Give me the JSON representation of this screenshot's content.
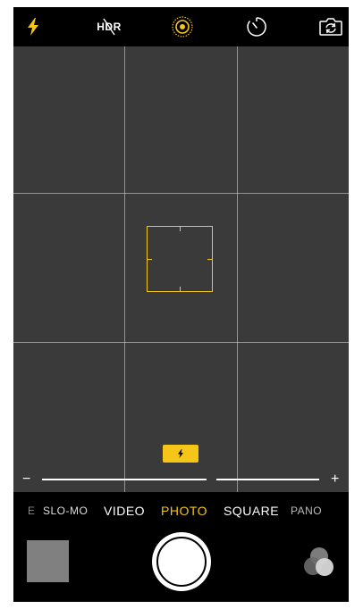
{
  "topbar": {
    "flash_icon": "flash-icon",
    "hdr_label": "HDR",
    "live_photo_icon": "live-photo-icon",
    "timer_icon": "timer-icon",
    "switch_camera_icon": "switch-camera-icon"
  },
  "viewfinder": {
    "grid": "3x3",
    "flash_badge_icon": "flash-icon"
  },
  "zoom": {
    "minus": "−",
    "plus": "+"
  },
  "modes": {
    "partial_label": "E",
    "slomo": "SLO-MO",
    "video": "VIDEO",
    "photo": "PHOTO",
    "square": "SQUARE",
    "pano": "PANO"
  },
  "colors": {
    "accent": "#f5c518",
    "background": "#000000",
    "viewfinder": "#3a3a3a",
    "text": "#ffffff"
  }
}
